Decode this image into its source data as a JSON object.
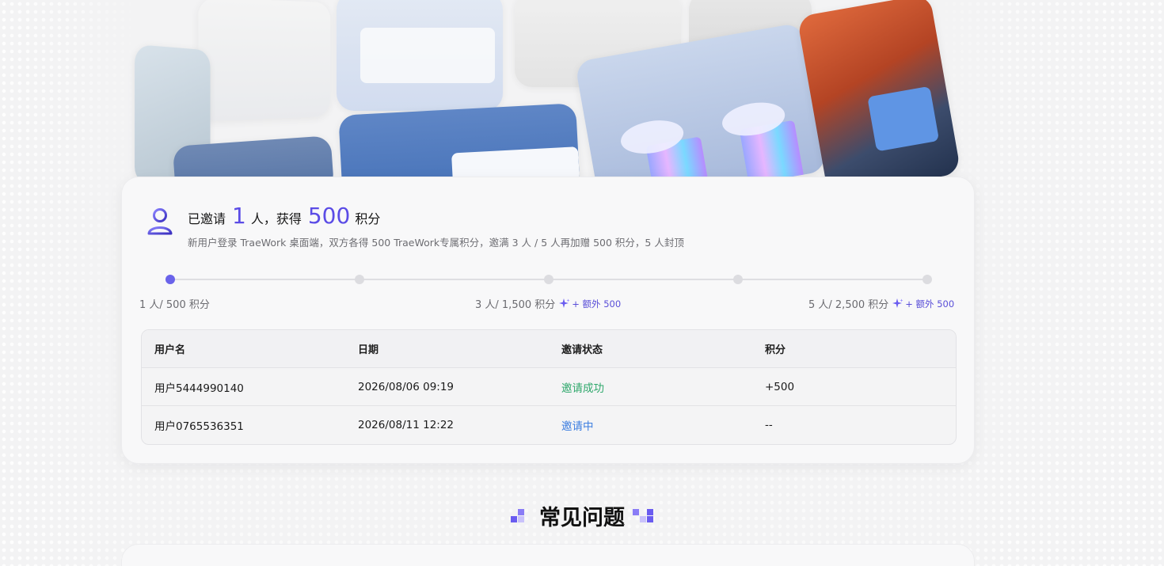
{
  "summary": {
    "prefix": "已邀请",
    "invited_count": "1",
    "mid": "人，获得",
    "points": "500",
    "suffix": "积分",
    "description": "新用户登录 TraeWork 桌面端，双方各得 500 TraeWork专属积分，邀满 3 人 / 5 人再加赠 500 积分，5 人封顶"
  },
  "milestones": [
    {
      "label": "1 人/ 500 积分",
      "bonus": ""
    },
    {
      "label": "3 人/ 1,500 积分",
      "bonus": "+ 额外 500"
    },
    {
      "label": "5 人/ 2,500 积分",
      "bonus": "+ 额外 500"
    }
  ],
  "progress": {
    "steps": 5,
    "current_step": 1
  },
  "table": {
    "headers": [
      "用户名",
      "日期",
      "邀请状态",
      "积分"
    ],
    "rows": [
      {
        "user": "用户5444990140",
        "date": "2026/08/06 09:19",
        "status": "邀请成功",
        "points": "+500",
        "status_type": "success"
      },
      {
        "user": "用户0765536351",
        "date": "2026/08/11 12:22",
        "status": "邀请中",
        "points": "--",
        "status_type": "pending"
      }
    ]
  },
  "faq": {
    "title": "常见问题"
  },
  "colors": {
    "accent": "#5b4ce6",
    "success": "#2fa86c",
    "pending": "#3b7de0",
    "background": "#f3f3f4"
  },
  "icons": {
    "avatar": "user-avatar-icon",
    "bonus": "sparkle-icon",
    "faq_decoration": "pixel-cluster-icon"
  }
}
